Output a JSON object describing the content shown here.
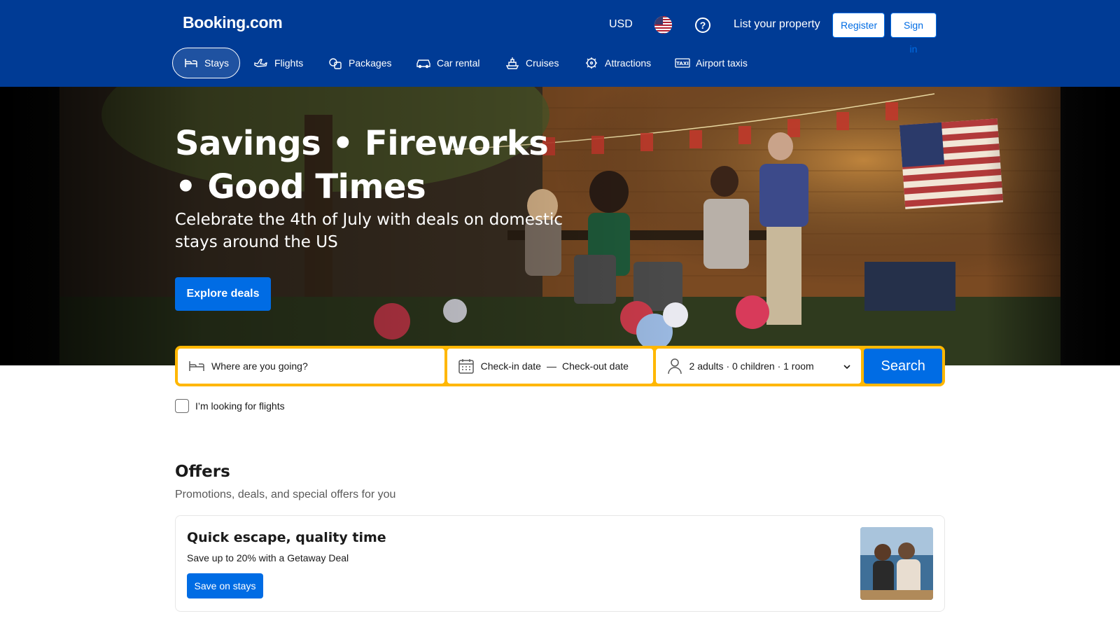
{
  "header": {
    "logo": "Booking.com",
    "currency": "USD",
    "list_property": "List your property",
    "register": "Register",
    "sign_in": "Sign in",
    "icons": {
      "flag": "us-flag-icon",
      "help": "help-icon"
    }
  },
  "nav": {
    "items": [
      {
        "label": "Stays",
        "icon": "bed-icon",
        "active": true
      },
      {
        "label": "Flights",
        "icon": "plane-icon"
      },
      {
        "label": "Packages",
        "icon": "packages-icon"
      },
      {
        "label": "Car rental",
        "icon": "car-icon"
      },
      {
        "label": "Cruises",
        "icon": "cruise-icon"
      },
      {
        "label": "Attractions",
        "icon": "attractions-icon"
      },
      {
        "label": "Airport taxis",
        "icon": "taxi-icon"
      }
    ]
  },
  "hero": {
    "title": "Savings • Fireworks • Good Times",
    "subtitle": "Celebrate the 4th of July with deals on domestic stays around the US",
    "cta": "Explore deals"
  },
  "search": {
    "destination_placeholder": "Where are you going?",
    "checkin": "Check-in date",
    "dash": "—",
    "checkout": "Check-out date",
    "guests": "2 adults · 0 children · 1 room",
    "button": "Search",
    "flights_checkbox": "I’m looking for flights"
  },
  "offers": {
    "title": "Offers",
    "subtitle": "Promotions, deals, and special offers for you",
    "card": {
      "title": "Quick escape, quality time",
      "description": "Save up to 20% with a Getaway Deal",
      "button": "Save on stays"
    }
  },
  "colors": {
    "header_bg": "#003b95",
    "primary": "#006ce4",
    "search_border": "#ffb700"
  }
}
